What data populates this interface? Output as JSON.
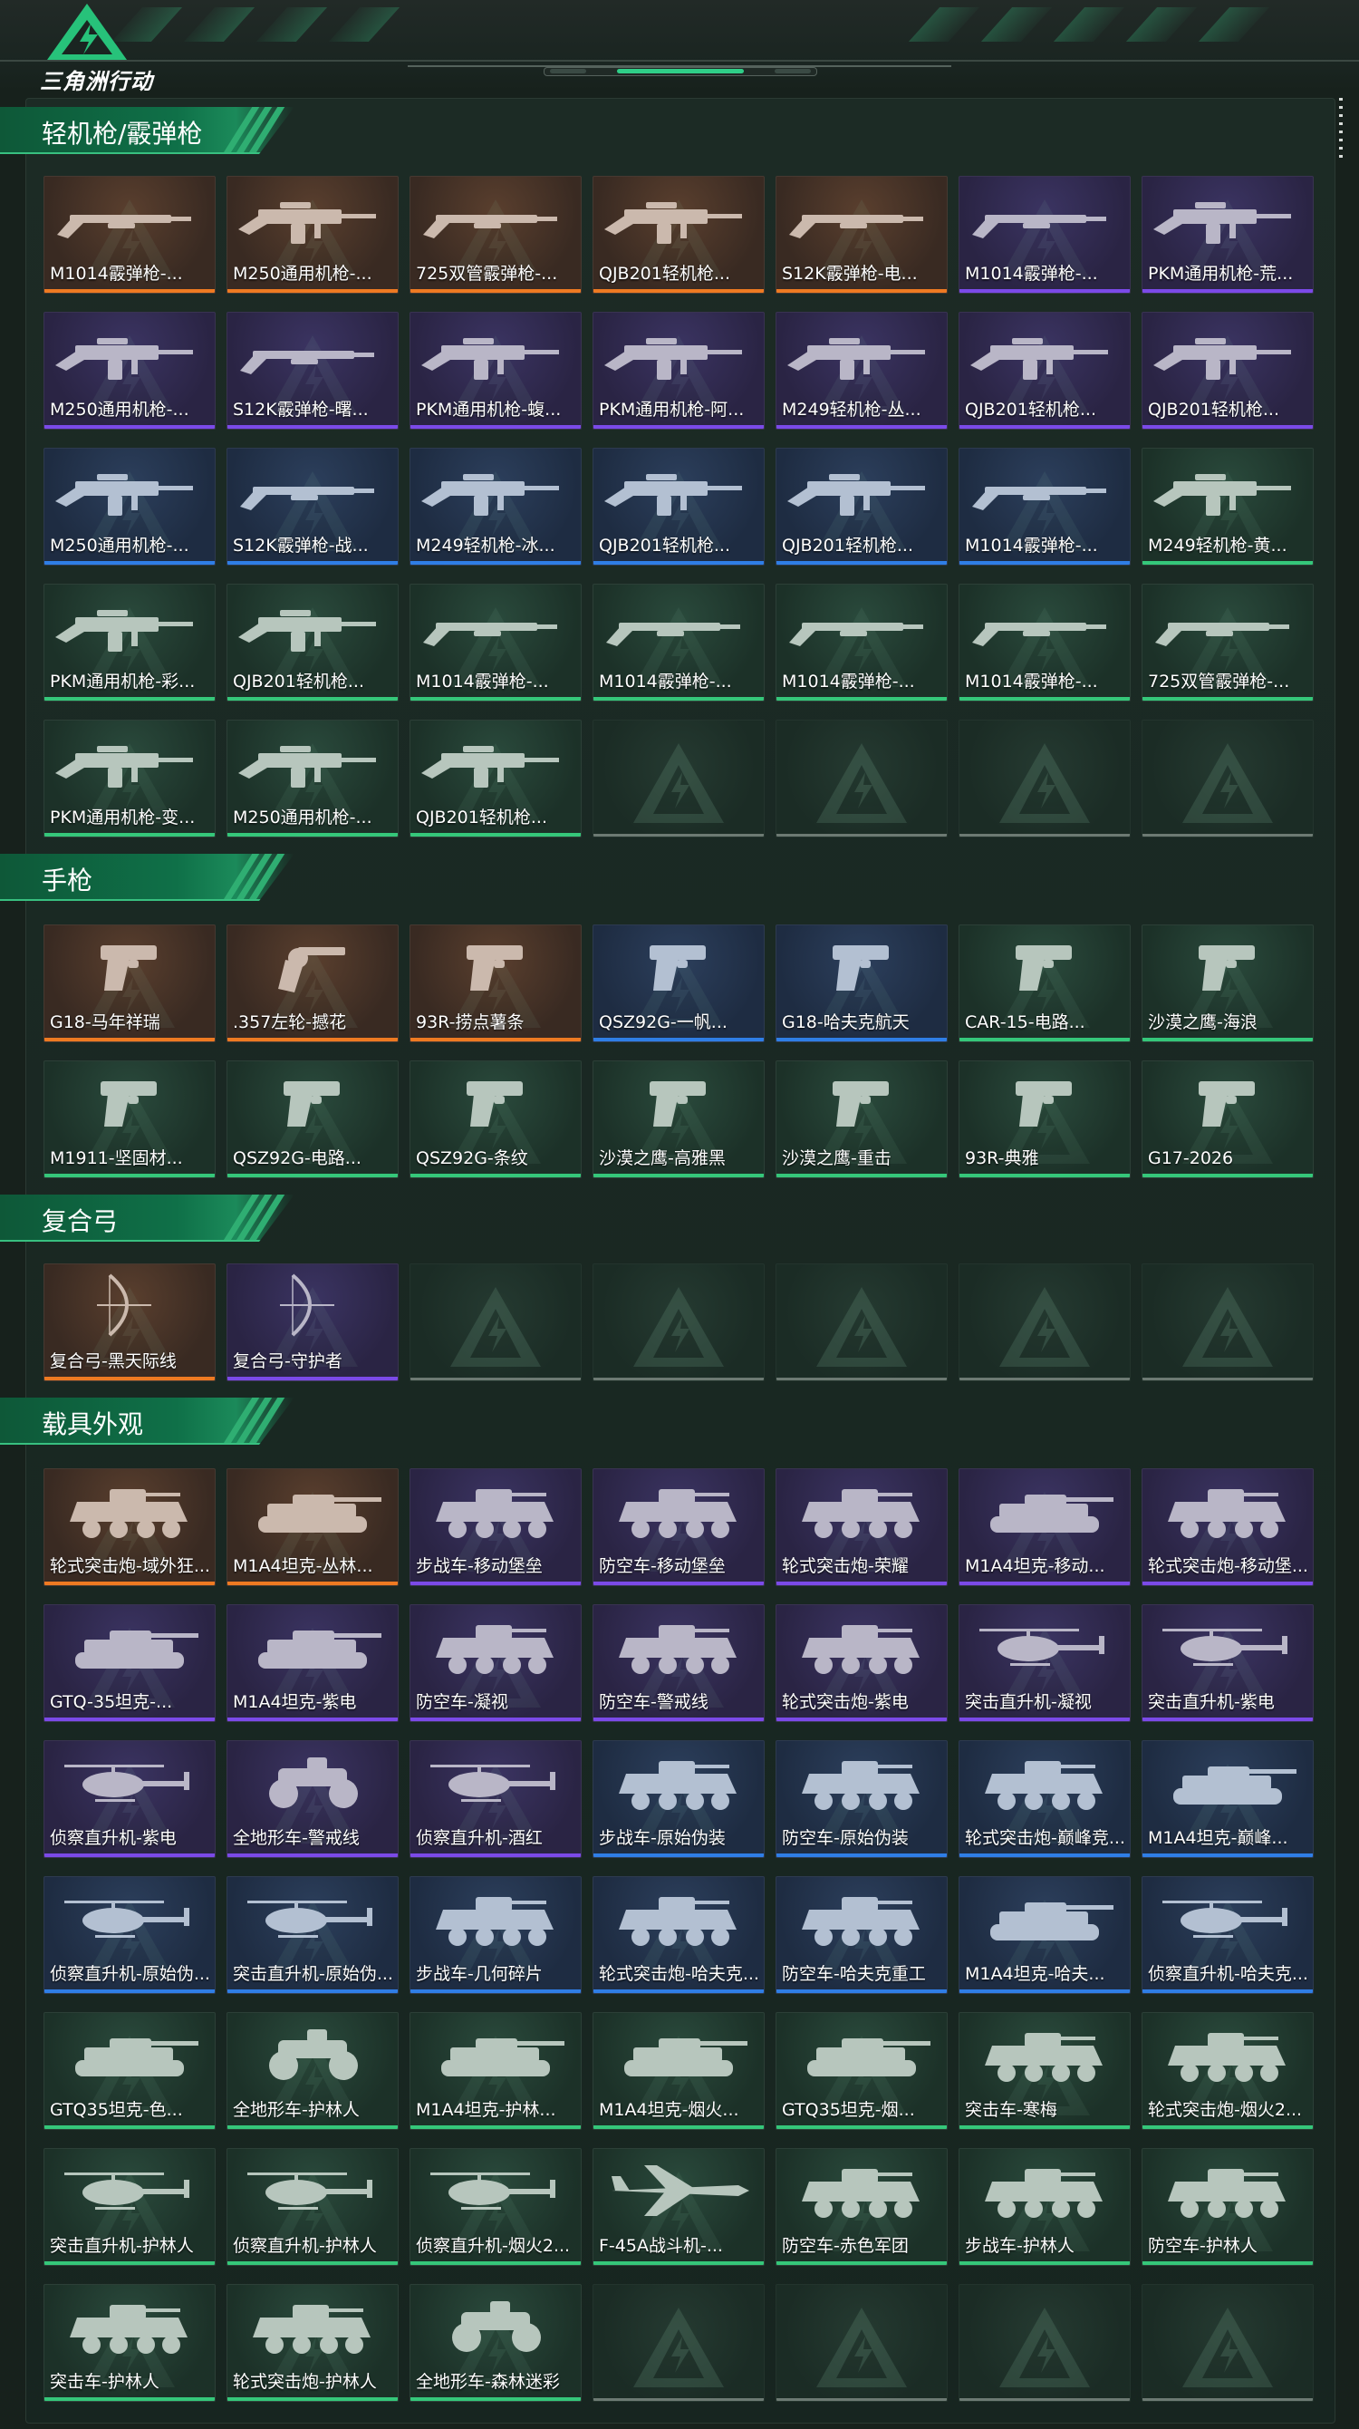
{
  "app": {
    "logo_text": "三角洲行动"
  },
  "colors": {
    "orange": "#ee7a22",
    "purple": "#7b4ae8",
    "blue": "#2f7ee6",
    "green": "#35c77a",
    "accent_green": "#0f7048",
    "background": "#17211c"
  },
  "sections": [
    {
      "title": "轻机枪/霰弹枪",
      "items": [
        {
          "name": "M1014霰弹枪-...",
          "rarity": "orange",
          "icon": "shotgun-icon"
        },
        {
          "name": "M250通用机枪-...",
          "rarity": "orange",
          "icon": "machine-gun-icon"
        },
        {
          "name": "725双管霰弹枪-...",
          "rarity": "orange",
          "icon": "shotgun-icon"
        },
        {
          "name": "QJB201轻机枪...",
          "rarity": "orange",
          "icon": "machine-gun-icon"
        },
        {
          "name": "S12K霰弹枪-电...",
          "rarity": "orange",
          "icon": "shotgun-icon"
        },
        {
          "name": "M1014霰弹枪-...",
          "rarity": "purple",
          "icon": "shotgun-icon"
        },
        {
          "name": "PKM通用机枪-荒...",
          "rarity": "purple",
          "icon": "machine-gun-icon"
        },
        {
          "name": "M250通用机枪-...",
          "rarity": "purple",
          "icon": "machine-gun-icon"
        },
        {
          "name": "S12K霰弹枪-曙...",
          "rarity": "purple",
          "icon": "shotgun-icon"
        },
        {
          "name": "PKM通用机枪-蝮...",
          "rarity": "purple",
          "icon": "machine-gun-icon"
        },
        {
          "name": "PKM通用机枪-阿...",
          "rarity": "purple",
          "icon": "machine-gun-icon"
        },
        {
          "name": "M249轻机枪-丛...",
          "rarity": "purple",
          "icon": "machine-gun-icon"
        },
        {
          "name": "QJB201轻机枪...",
          "rarity": "purple",
          "icon": "machine-gun-icon"
        },
        {
          "name": "QJB201轻机枪...",
          "rarity": "purple",
          "icon": "machine-gun-icon"
        },
        {
          "name": "M250通用机枪-...",
          "rarity": "blue",
          "icon": "machine-gun-icon"
        },
        {
          "name": "S12K霰弹枪-战...",
          "rarity": "blue",
          "icon": "shotgun-icon"
        },
        {
          "name": "M249轻机枪-冰...",
          "rarity": "blue",
          "icon": "machine-gun-icon"
        },
        {
          "name": "QJB201轻机枪...",
          "rarity": "blue",
          "icon": "machine-gun-icon"
        },
        {
          "name": "QJB201轻机枪...",
          "rarity": "blue",
          "icon": "machine-gun-icon"
        },
        {
          "name": "M1014霰弹枪-...",
          "rarity": "blue",
          "icon": "shotgun-icon"
        },
        {
          "name": "M249轻机枪-黄...",
          "rarity": "green",
          "icon": "machine-gun-icon"
        },
        {
          "name": "PKM通用机枪-彩...",
          "rarity": "green",
          "icon": "machine-gun-icon"
        },
        {
          "name": "QJB201轻机枪...",
          "rarity": "green",
          "icon": "machine-gun-icon"
        },
        {
          "name": "M1014霰弹枪-...",
          "rarity": "green",
          "icon": "shotgun-icon"
        },
        {
          "name": "M1014霰弹枪-...",
          "rarity": "green",
          "icon": "shotgun-icon"
        },
        {
          "name": "M1014霰弹枪-...",
          "rarity": "green",
          "icon": "shotgun-icon"
        },
        {
          "name": "M1014霰弹枪-...",
          "rarity": "green",
          "icon": "shotgun-icon"
        },
        {
          "name": "725双管霰弹枪-...",
          "rarity": "green",
          "icon": "shotgun-icon"
        },
        {
          "name": "PKM通用机枪-变...",
          "rarity": "green",
          "icon": "machine-gun-icon"
        },
        {
          "name": "M250通用机枪-...",
          "rarity": "green",
          "icon": "machine-gun-icon"
        },
        {
          "name": "QJB201轻机枪...",
          "rarity": "green",
          "icon": "machine-gun-icon"
        },
        {
          "name": "",
          "rarity": "empty",
          "icon": "delta-logo-icon"
        },
        {
          "name": "",
          "rarity": "empty",
          "icon": "delta-logo-icon"
        },
        {
          "name": "",
          "rarity": "empty",
          "icon": "delta-logo-icon"
        },
        {
          "name": "",
          "rarity": "empty",
          "icon": "delta-logo-icon"
        }
      ]
    },
    {
      "title": "手枪",
      "items": [
        {
          "name": "G18-马年祥瑞",
          "rarity": "orange",
          "icon": "pistol-icon"
        },
        {
          "name": ".357左轮-撼花",
          "rarity": "orange",
          "icon": "revolver-icon"
        },
        {
          "name": "93R-捞点薯条",
          "rarity": "orange",
          "icon": "pistol-icon"
        },
        {
          "name": "QSZ92G-一帆...",
          "rarity": "blue",
          "icon": "pistol-icon"
        },
        {
          "name": "G18-哈夫克航天",
          "rarity": "blue",
          "icon": "pistol-icon"
        },
        {
          "name": "CAR-15-电路...",
          "rarity": "green",
          "icon": "pistol-icon"
        },
        {
          "name": "沙漠之鹰-海浪",
          "rarity": "green",
          "icon": "pistol-icon"
        },
        {
          "name": "M1911-坚固材...",
          "rarity": "green",
          "icon": "pistol-icon"
        },
        {
          "name": "QSZ92G-电路...",
          "rarity": "green",
          "icon": "pistol-icon"
        },
        {
          "name": "QSZ92G-条纹",
          "rarity": "green",
          "icon": "pistol-icon"
        },
        {
          "name": "沙漠之鹰-高雅黑",
          "rarity": "green",
          "icon": "pistol-icon"
        },
        {
          "name": "沙漠之鹰-重击",
          "rarity": "green",
          "icon": "pistol-icon"
        },
        {
          "name": "93R-典雅",
          "rarity": "green",
          "icon": "pistol-icon"
        },
        {
          "name": "G17-2026",
          "rarity": "green",
          "icon": "pistol-icon"
        }
      ]
    },
    {
      "title": "复合弓",
      "items": [
        {
          "name": "复合弓-黑天际线",
          "rarity": "orange",
          "icon": "bow-icon"
        },
        {
          "name": "复合弓-守护者",
          "rarity": "purple",
          "icon": "bow-icon"
        },
        {
          "name": "",
          "rarity": "empty",
          "icon": "delta-logo-icon"
        },
        {
          "name": "",
          "rarity": "empty",
          "icon": "delta-logo-icon"
        },
        {
          "name": "",
          "rarity": "empty",
          "icon": "delta-logo-icon"
        },
        {
          "name": "",
          "rarity": "empty",
          "icon": "delta-logo-icon"
        },
        {
          "name": "",
          "rarity": "empty",
          "icon": "delta-logo-icon"
        }
      ]
    },
    {
      "title": "载具外观",
      "items": [
        {
          "name": "轮式突击炮-域外狂...",
          "rarity": "orange",
          "icon": "wheeled-vehicle-icon"
        },
        {
          "name": "M1A4坦克-丛林...",
          "rarity": "orange",
          "icon": "tank-icon"
        },
        {
          "name": "步战车-移动堡垒",
          "rarity": "purple",
          "icon": "wheeled-vehicle-icon"
        },
        {
          "name": "防空车-移动堡垒",
          "rarity": "purple",
          "icon": "wheeled-vehicle-icon"
        },
        {
          "name": "轮式突击炮-荣耀",
          "rarity": "purple",
          "icon": "wheeled-vehicle-icon"
        },
        {
          "name": "M1A4坦克-移动...",
          "rarity": "purple",
          "icon": "tank-icon"
        },
        {
          "name": "轮式突击炮-移动堡...",
          "rarity": "purple",
          "icon": "wheeled-vehicle-icon"
        },
        {
          "name": "GTQ-35坦克-...",
          "rarity": "purple",
          "icon": "tank-icon"
        },
        {
          "name": "M1A4坦克-紫电",
          "rarity": "purple",
          "icon": "tank-icon"
        },
        {
          "name": "防空车-凝视",
          "rarity": "purple",
          "icon": "wheeled-vehicle-icon"
        },
        {
          "name": "防空车-警戒线",
          "rarity": "purple",
          "icon": "wheeled-vehicle-icon"
        },
        {
          "name": "轮式突击炮-紫电",
          "rarity": "purple",
          "icon": "wheeled-vehicle-icon"
        },
        {
          "name": "突击直升机-凝视",
          "rarity": "purple",
          "icon": "helicopter-icon"
        },
        {
          "name": "突击直升机-紫电",
          "rarity": "purple",
          "icon": "helicopter-icon"
        },
        {
          "name": "侦察直升机-紫电",
          "rarity": "purple",
          "icon": "helicopter-icon"
        },
        {
          "name": "全地形车-警戒线",
          "rarity": "purple",
          "icon": "atv-icon"
        },
        {
          "name": "侦察直升机-酒红",
          "rarity": "purple",
          "icon": "helicopter-icon"
        },
        {
          "name": "步战车-原始伪装",
          "rarity": "blue",
          "icon": "wheeled-vehicle-icon"
        },
        {
          "name": "防空车-原始伪装",
          "rarity": "blue",
          "icon": "wheeled-vehicle-icon"
        },
        {
          "name": "轮式突击炮-巅峰竞...",
          "rarity": "blue",
          "icon": "wheeled-vehicle-icon"
        },
        {
          "name": "M1A4坦克-巅峰...",
          "rarity": "blue",
          "icon": "tank-icon"
        },
        {
          "name": "侦察直升机-原始伪...",
          "rarity": "blue",
          "icon": "helicopter-icon"
        },
        {
          "name": "突击直升机-原始伪...",
          "rarity": "blue",
          "icon": "helicopter-icon"
        },
        {
          "name": "步战车-几何碎片",
          "rarity": "blue",
          "icon": "wheeled-vehicle-icon"
        },
        {
          "name": "轮式突击炮-哈夫克...",
          "rarity": "blue",
          "icon": "wheeled-vehicle-icon"
        },
        {
          "name": "防空车-哈夫克重工",
          "rarity": "blue",
          "icon": "wheeled-vehicle-icon"
        },
        {
          "name": "M1A4坦克-哈夫...",
          "rarity": "blue",
          "icon": "tank-icon"
        },
        {
          "name": "侦察直升机-哈夫克...",
          "rarity": "blue",
          "icon": "helicopter-icon"
        },
        {
          "name": "GTQ35坦克-色...",
          "rarity": "green",
          "icon": "tank-icon"
        },
        {
          "name": "全地形车-护林人",
          "rarity": "green",
          "icon": "atv-icon"
        },
        {
          "name": "M1A4坦克-护林...",
          "rarity": "green",
          "icon": "tank-icon"
        },
        {
          "name": "M1A4坦克-烟火...",
          "rarity": "green",
          "icon": "tank-icon"
        },
        {
          "name": "GTQ35坦克-烟...",
          "rarity": "green",
          "icon": "tank-icon"
        },
        {
          "name": "突击车-寒梅",
          "rarity": "green",
          "icon": "wheeled-vehicle-icon"
        },
        {
          "name": "轮式突击炮-烟火2...",
          "rarity": "green",
          "icon": "wheeled-vehicle-icon"
        },
        {
          "name": "突击直升机-护林人",
          "rarity": "green",
          "icon": "helicopter-icon"
        },
        {
          "name": "侦察直升机-护林人",
          "rarity": "green",
          "icon": "helicopter-icon"
        },
        {
          "name": "侦察直升机-烟火2...",
          "rarity": "green",
          "icon": "helicopter-icon"
        },
        {
          "name": "F-45A战斗机-...",
          "rarity": "green",
          "icon": "jet-icon"
        },
        {
          "name": "防空车-赤色军团",
          "rarity": "green",
          "icon": "wheeled-vehicle-icon"
        },
        {
          "name": "步战车-护林人",
          "rarity": "green",
          "icon": "wheeled-vehicle-icon"
        },
        {
          "name": "防空车-护林人",
          "rarity": "green",
          "icon": "wheeled-vehicle-icon"
        },
        {
          "name": "突击车-护林人",
          "rarity": "green",
          "icon": "wheeled-vehicle-icon"
        },
        {
          "name": "轮式突击炮-护林人",
          "rarity": "green",
          "icon": "wheeled-vehicle-icon"
        },
        {
          "name": "全地形车-森林迷彩",
          "rarity": "green",
          "icon": "atv-icon"
        },
        {
          "name": "",
          "rarity": "empty",
          "icon": "delta-logo-icon"
        },
        {
          "name": "",
          "rarity": "empty",
          "icon": "delta-logo-icon"
        },
        {
          "name": "",
          "rarity": "empty",
          "icon": "delta-logo-icon"
        },
        {
          "name": "",
          "rarity": "empty",
          "icon": "delta-logo-icon"
        }
      ]
    }
  ]
}
